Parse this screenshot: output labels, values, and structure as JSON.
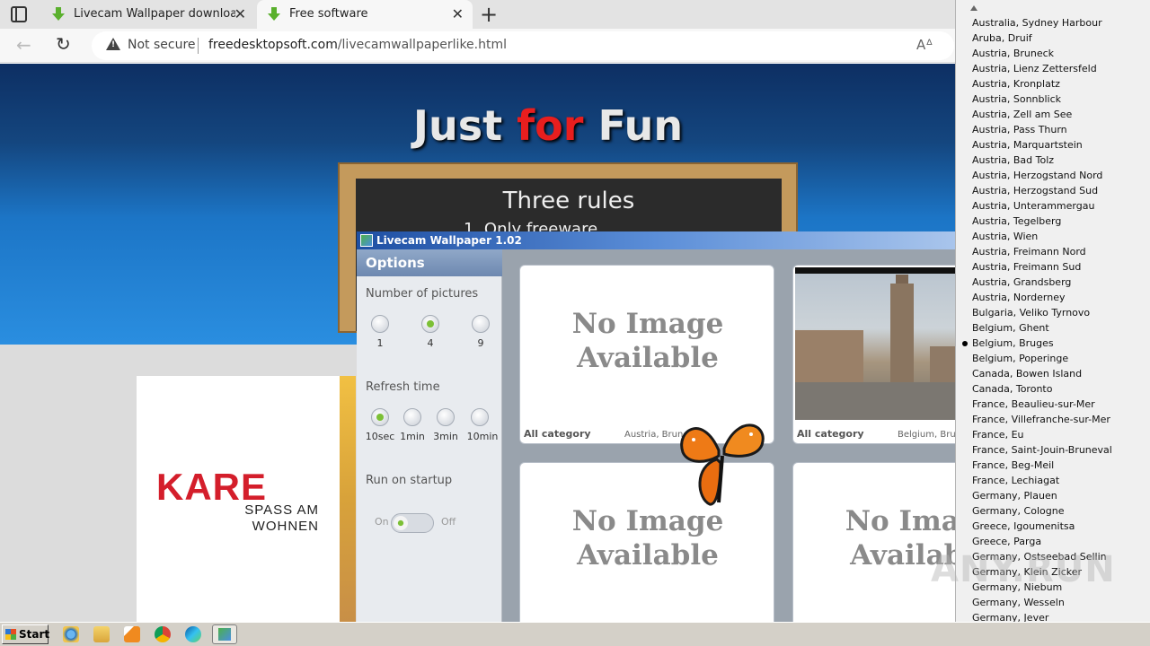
{
  "browser": {
    "tabs": [
      {
        "label": "Livecam Wallpaper download page"
      },
      {
        "label": "Free software"
      }
    ],
    "security_label": "Not secure",
    "url_host": "freedesktopsoft.com",
    "url_path": "/livecamwallpaperlike.html",
    "reader_label": "A"
  },
  "page": {
    "title_part1": "Just ",
    "title_part2": "for",
    "title_part3": " Fun",
    "board_title": "Three rules",
    "board_rule1": "1. Only freeware",
    "ad_brand": "KARE",
    "ad_tagline": "SPASS AM WOHNEN"
  },
  "app": {
    "title": "Livecam Wallpaper 1.02",
    "options_header": "Options",
    "number_label": "Number of pictures",
    "number_options": [
      "1",
      "4",
      "9"
    ],
    "number_selected": "4",
    "refresh_label": "Refresh time",
    "refresh_options": [
      "10sec",
      "1min",
      "3min",
      "10min"
    ],
    "refresh_selected": "10sec",
    "startup_label": "Run on startup",
    "startup_on": "On",
    "startup_off": "Off",
    "cells": [
      {
        "no_image": "No Image Available",
        "category": "All category",
        "location": "Austria, Bruneck"
      },
      {
        "category": "All category",
        "location": "Belgium, Bruges"
      },
      {
        "no_image": "No Image Available"
      },
      {
        "no_image": "No Image Available"
      }
    ]
  },
  "dropdown": {
    "selected": "Belgium, Bruges",
    "items": [
      "Australia, Sydney Harbour",
      "Aruba, Druif",
      "Austria, Bruneck",
      "Austria, Lienz Zettersfeld",
      "Austria, Kronplatz",
      "Austria, Sonnblick",
      "Austria, Zell am See",
      "Austria, Pass Thurn",
      "Austria, Marquartstein",
      "Austria, Bad Tolz",
      "Austria, Herzogstand Nord",
      "Austria, Herzogstand Sud",
      "Austria, Unterammergau",
      "Austria, Tegelberg",
      "Austria, Wien",
      "Austria, Freimann Nord",
      "Austria, Freimann Sud",
      "Austria, Grandsberg",
      "Austria, Norderney",
      "Bulgaria, Veliko Tyrnovo",
      "Belgium, Ghent",
      "Belgium, Bruges",
      "Belgium, Poperinge",
      "Canada, Bowen Island",
      "Canada, Toronto",
      "France, Beaulieu-sur-Mer",
      "France, Villefranche-sur-Mer",
      "France, Eu",
      "France, Saint-Jouin-Bruneval",
      "France, Beg-Meil",
      "France, Lechiagat",
      "Germany, Plauen",
      "Germany, Cologne",
      "Greece, Igoumenitsa",
      "Greece, Parga",
      "Germany, Ostseebad Sellin",
      "Germany, Klein Zicker",
      "Germany, Niebum",
      "Germany, Wesseln",
      "Germany, Jever"
    ]
  },
  "watermark": "ANY.RUN",
  "taskbar": {
    "start_label": "Start",
    "icons": [
      "ie-icon",
      "folder-icon",
      "media-player-icon",
      "chrome-icon",
      "edge-icon",
      "livecam-app-icon"
    ]
  },
  "colors": {
    "accent_red": "#e81e1e",
    "selection_green": "#7cc035",
    "brand_red": "#d41e2b"
  }
}
